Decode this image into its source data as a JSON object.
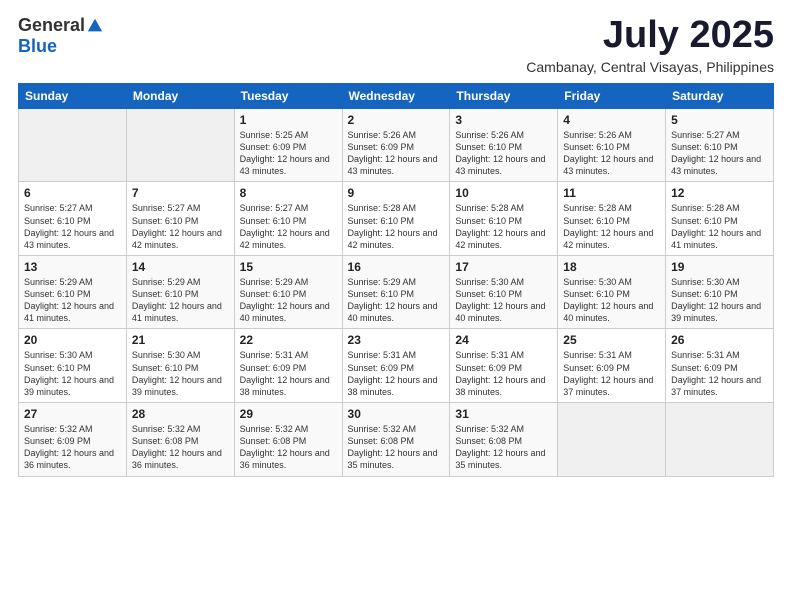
{
  "logo": {
    "general": "General",
    "blue": "Blue"
  },
  "title": {
    "month": "July 2025",
    "location": "Cambanay, Central Visayas, Philippines"
  },
  "weekdays": [
    "Sunday",
    "Monday",
    "Tuesday",
    "Wednesday",
    "Thursday",
    "Friday",
    "Saturday"
  ],
  "weeks": [
    [
      {
        "day": "",
        "text": ""
      },
      {
        "day": "",
        "text": ""
      },
      {
        "day": "1",
        "text": "Sunrise: 5:25 AM\nSunset: 6:09 PM\nDaylight: 12 hours and 43 minutes."
      },
      {
        "day": "2",
        "text": "Sunrise: 5:26 AM\nSunset: 6:09 PM\nDaylight: 12 hours and 43 minutes."
      },
      {
        "day": "3",
        "text": "Sunrise: 5:26 AM\nSunset: 6:10 PM\nDaylight: 12 hours and 43 minutes."
      },
      {
        "day": "4",
        "text": "Sunrise: 5:26 AM\nSunset: 6:10 PM\nDaylight: 12 hours and 43 minutes."
      },
      {
        "day": "5",
        "text": "Sunrise: 5:27 AM\nSunset: 6:10 PM\nDaylight: 12 hours and 43 minutes."
      }
    ],
    [
      {
        "day": "6",
        "text": "Sunrise: 5:27 AM\nSunset: 6:10 PM\nDaylight: 12 hours and 43 minutes."
      },
      {
        "day": "7",
        "text": "Sunrise: 5:27 AM\nSunset: 6:10 PM\nDaylight: 12 hours and 42 minutes."
      },
      {
        "day": "8",
        "text": "Sunrise: 5:27 AM\nSunset: 6:10 PM\nDaylight: 12 hours and 42 minutes."
      },
      {
        "day": "9",
        "text": "Sunrise: 5:28 AM\nSunset: 6:10 PM\nDaylight: 12 hours and 42 minutes."
      },
      {
        "day": "10",
        "text": "Sunrise: 5:28 AM\nSunset: 6:10 PM\nDaylight: 12 hours and 42 minutes."
      },
      {
        "day": "11",
        "text": "Sunrise: 5:28 AM\nSunset: 6:10 PM\nDaylight: 12 hours and 42 minutes."
      },
      {
        "day": "12",
        "text": "Sunrise: 5:28 AM\nSunset: 6:10 PM\nDaylight: 12 hours and 41 minutes."
      }
    ],
    [
      {
        "day": "13",
        "text": "Sunrise: 5:29 AM\nSunset: 6:10 PM\nDaylight: 12 hours and 41 minutes."
      },
      {
        "day": "14",
        "text": "Sunrise: 5:29 AM\nSunset: 6:10 PM\nDaylight: 12 hours and 41 minutes."
      },
      {
        "day": "15",
        "text": "Sunrise: 5:29 AM\nSunset: 6:10 PM\nDaylight: 12 hours and 40 minutes."
      },
      {
        "day": "16",
        "text": "Sunrise: 5:29 AM\nSunset: 6:10 PM\nDaylight: 12 hours and 40 minutes."
      },
      {
        "day": "17",
        "text": "Sunrise: 5:30 AM\nSunset: 6:10 PM\nDaylight: 12 hours and 40 minutes."
      },
      {
        "day": "18",
        "text": "Sunrise: 5:30 AM\nSunset: 6:10 PM\nDaylight: 12 hours and 40 minutes."
      },
      {
        "day": "19",
        "text": "Sunrise: 5:30 AM\nSunset: 6:10 PM\nDaylight: 12 hours and 39 minutes."
      }
    ],
    [
      {
        "day": "20",
        "text": "Sunrise: 5:30 AM\nSunset: 6:10 PM\nDaylight: 12 hours and 39 minutes."
      },
      {
        "day": "21",
        "text": "Sunrise: 5:30 AM\nSunset: 6:10 PM\nDaylight: 12 hours and 39 minutes."
      },
      {
        "day": "22",
        "text": "Sunrise: 5:31 AM\nSunset: 6:09 PM\nDaylight: 12 hours and 38 minutes."
      },
      {
        "day": "23",
        "text": "Sunrise: 5:31 AM\nSunset: 6:09 PM\nDaylight: 12 hours and 38 minutes."
      },
      {
        "day": "24",
        "text": "Sunrise: 5:31 AM\nSunset: 6:09 PM\nDaylight: 12 hours and 38 minutes."
      },
      {
        "day": "25",
        "text": "Sunrise: 5:31 AM\nSunset: 6:09 PM\nDaylight: 12 hours and 37 minutes."
      },
      {
        "day": "26",
        "text": "Sunrise: 5:31 AM\nSunset: 6:09 PM\nDaylight: 12 hours and 37 minutes."
      }
    ],
    [
      {
        "day": "27",
        "text": "Sunrise: 5:32 AM\nSunset: 6:09 PM\nDaylight: 12 hours and 36 minutes."
      },
      {
        "day": "28",
        "text": "Sunrise: 5:32 AM\nSunset: 6:08 PM\nDaylight: 12 hours and 36 minutes."
      },
      {
        "day": "29",
        "text": "Sunrise: 5:32 AM\nSunset: 6:08 PM\nDaylight: 12 hours and 36 minutes."
      },
      {
        "day": "30",
        "text": "Sunrise: 5:32 AM\nSunset: 6:08 PM\nDaylight: 12 hours and 35 minutes."
      },
      {
        "day": "31",
        "text": "Sunrise: 5:32 AM\nSunset: 6:08 PM\nDaylight: 12 hours and 35 minutes."
      },
      {
        "day": "",
        "text": ""
      },
      {
        "day": "",
        "text": ""
      }
    ]
  ]
}
